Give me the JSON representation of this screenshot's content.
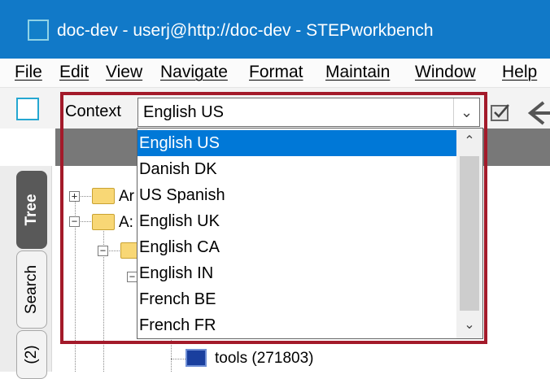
{
  "window": {
    "title": "doc-dev - userj@http://doc-dev - STEPworkbench"
  },
  "menu": [
    "File",
    "Edit",
    "View",
    "Navigate",
    "Format",
    "Maintain",
    "Window",
    "Help"
  ],
  "context": {
    "label": "Context",
    "selected": "English US"
  },
  "dropdown": {
    "options": [
      "English US",
      "Danish DK",
      "US Spanish",
      "English UK",
      "English CA",
      "English IN",
      "French BE",
      "French FR"
    ],
    "selected_index": 0
  },
  "side_tabs": [
    "Tree",
    "Search",
    "(2)"
  ],
  "tree": {
    "node1_partial": "Ar",
    "node2_partial": "A:",
    "tools_label": "tools (271803)"
  },
  "colors": {
    "titlebar": "#1179c8",
    "selection": "#0078d7",
    "highlight_frame": "#a31a2a"
  }
}
